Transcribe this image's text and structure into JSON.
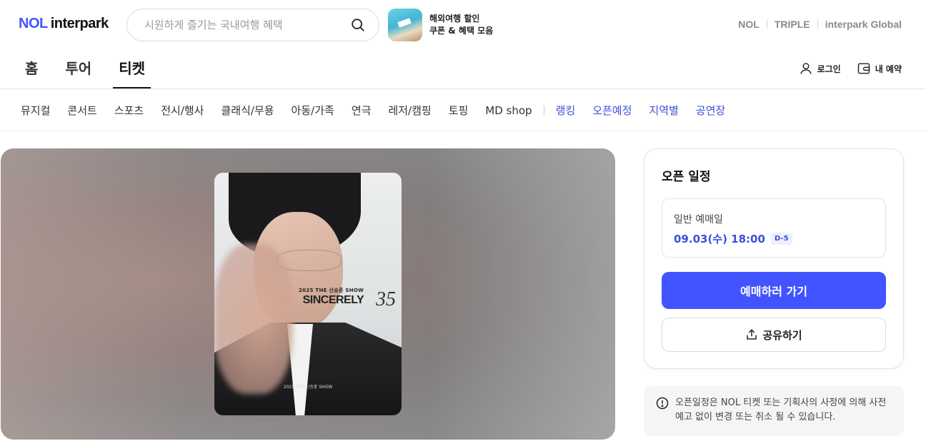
{
  "header": {
    "logo_nol": "NOL",
    "logo_interpark": "interpark",
    "search_placeholder": "시원하게 즐기는 국내여행 혜택",
    "promo_line1": "해외여행 할인",
    "promo_line2": "쿠폰 & 혜택 모음",
    "brands": [
      "NOL",
      "TRIPLE",
      "interpark Global"
    ]
  },
  "mainnav": {
    "tabs": [
      "홈",
      "투어",
      "티켓"
    ],
    "active_tab": "티켓",
    "login_label": "로그인",
    "reservation_label": "내 예약"
  },
  "subnav": {
    "categories": [
      "뮤지컬",
      "콘서트",
      "스포츠",
      "전시/행사",
      "클래식/무용",
      "아동/가족",
      "연극",
      "레저/캠핑",
      "토핑",
      "MD shop"
    ],
    "extras": [
      "랭킹",
      "오픈예정",
      "지역별",
      "공연장"
    ]
  },
  "poster": {
    "small_title": "2025 THE 신승훈 SHOW",
    "big_title": "SINCERELY",
    "number": "35",
    "footer": "2025 THE 신승훈 SHOW"
  },
  "panel": {
    "title": "오픈 일정",
    "schedule_label": "일반 예매일",
    "schedule_datetime": "09.03(수) 18:00",
    "dday_badge": "D-5",
    "book_button": "예매하러 가기",
    "share_button": "공유하기"
  },
  "notice": {
    "text": "오픈일정은 NOL 티켓 또는 기획사의 사정에 의해 사전예고 없이 변경 또는 취소 될 수 있습니다."
  },
  "colors": {
    "accent": "#4154ff",
    "link_blue": "#3d4fd9"
  }
}
